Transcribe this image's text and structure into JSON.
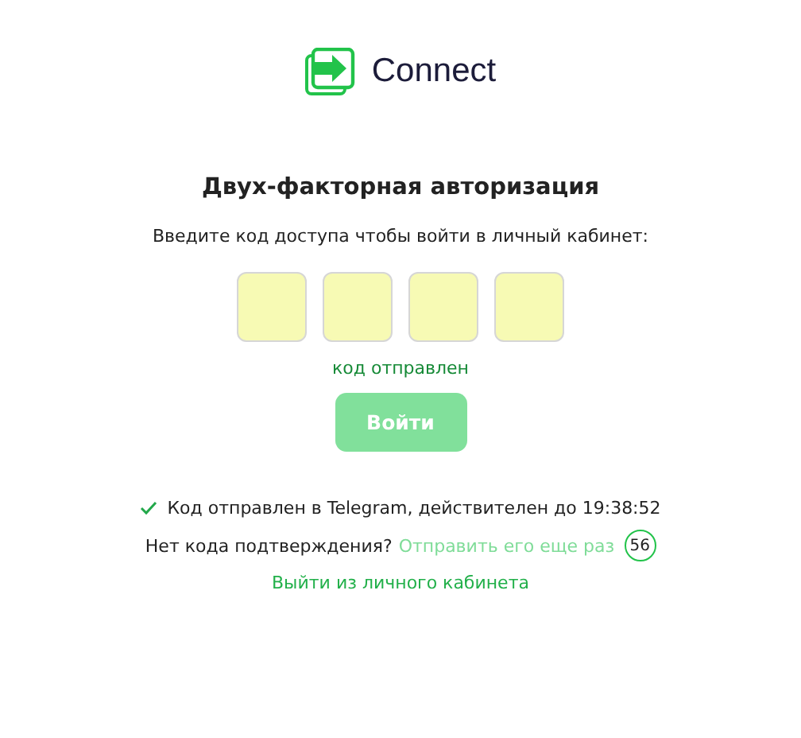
{
  "logo": {
    "text": "Connect"
  },
  "title": "Двух-факторная авторизация",
  "subtitle": "Введите код доступа чтобы войти в личный кабинет:",
  "code_fields": [
    {
      "kind": "digit"
    },
    {
      "kind": "digit"
    },
    {
      "kind": "digit"
    },
    {
      "kind": "digit"
    }
  ],
  "code_status": "код отправлен",
  "submit": {
    "label": "Войти",
    "disabled": true
  },
  "sent_notice": "Код отправлен в Telegram, действителен до 19:38:52",
  "resend": {
    "question": "Нет кода подтверждения?",
    "link": "Отправить его еще раз",
    "disabled": true,
    "countdown": "56"
  },
  "logout": "Выйти из личного кабинета"
}
